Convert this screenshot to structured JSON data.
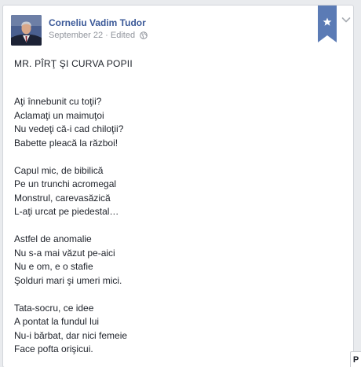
{
  "post": {
    "author": "Corneliu Vadim Tudor",
    "date": "September 22",
    "separator": " · ",
    "edited": "Edited",
    "privacy_icon": "globe-icon",
    "bookmark_icon": "star-icon",
    "menu_icon": "chevron-down-icon",
    "title": "MR. PÎRŢ ŞI CURVA POPII",
    "stanzas": [
      [
        "Aţi înnebunit cu toţii?",
        "Aclamaţi un maimuţoi",
        "Nu vedeţi că-i cad chiloţii?",
        "Babette pleacă la război!"
      ],
      [
        "Capul mic, de bibilică",
        "Pe un trunchi acromegal",
        "Monstrul, carevasăzică",
        "L-aţi urcat pe piedestal…"
      ],
      [
        "Astfel de anomalie",
        "Nu s-a mai văzut pe-aici",
        "Nu e om, e o stafie",
        "Şolduri mari şi umeri mici."
      ],
      [
        "Tata-socru, ce idee",
        "A pontat la fundul lui",
        "Nu-i bărbat, dar nici femeie",
        "Face pofta orişicui."
      ]
    ]
  },
  "corner_tab": {
    "label": "P"
  },
  "colors": {
    "link": "#3b5998",
    "text": "#1d2129",
    "meta": "#90949c",
    "bookmark": "#5b7bb5",
    "background": "#e9ebee"
  }
}
